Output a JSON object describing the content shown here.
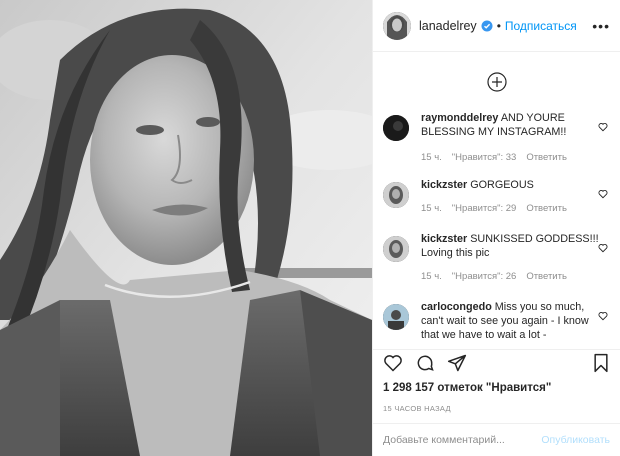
{
  "post": {
    "author": "lanadelrey",
    "verified": true,
    "separator": "•",
    "follow_label": "Подписаться",
    "more_label": "•••",
    "photo_alt": "Black and white selfie photo"
  },
  "comments": [
    {
      "user": "raymonddelrey",
      "text": "AND YOURE BLESSING MY INSTAGRAM!!",
      "time": "15 ч.",
      "likes": "\"Нравится\": 33",
      "reply": "Ответить"
    },
    {
      "user": "kickzster",
      "text": "GORGEOUS",
      "time": "15 ч.",
      "likes": "\"Нравится\": 29",
      "reply": "Ответить"
    },
    {
      "user": "kickzster",
      "text": "SUNKISSED GODDESS!!! Loving this pic",
      "time": "15 ч.",
      "likes": "\"Нравится\": 26",
      "reply": "Ответить"
    },
    {
      "user": "carlocongedo",
      "text": "Miss you so much, can't wait to see you again - I know that we have to wait a lot -",
      "time": "",
      "likes": "",
      "reply": ""
    }
  ],
  "stats": {
    "likes_text": "1 298 157 отметок \"Нравится\"",
    "posted_ago": "15 ЧАСОВ НАЗАД"
  },
  "compose": {
    "placeholder": "Добавьте комментарий...",
    "publish_label": "Опубликовать"
  },
  "colors": {
    "link": "#0095f6",
    "publish_disabled": "#b2dffc",
    "muted": "#8e8e8e"
  },
  "icons": [
    "verified-badge-icon",
    "more-options-icon",
    "load-more-plus-icon",
    "heart-icon",
    "comment-icon",
    "share-icon",
    "bookmark-icon"
  ]
}
